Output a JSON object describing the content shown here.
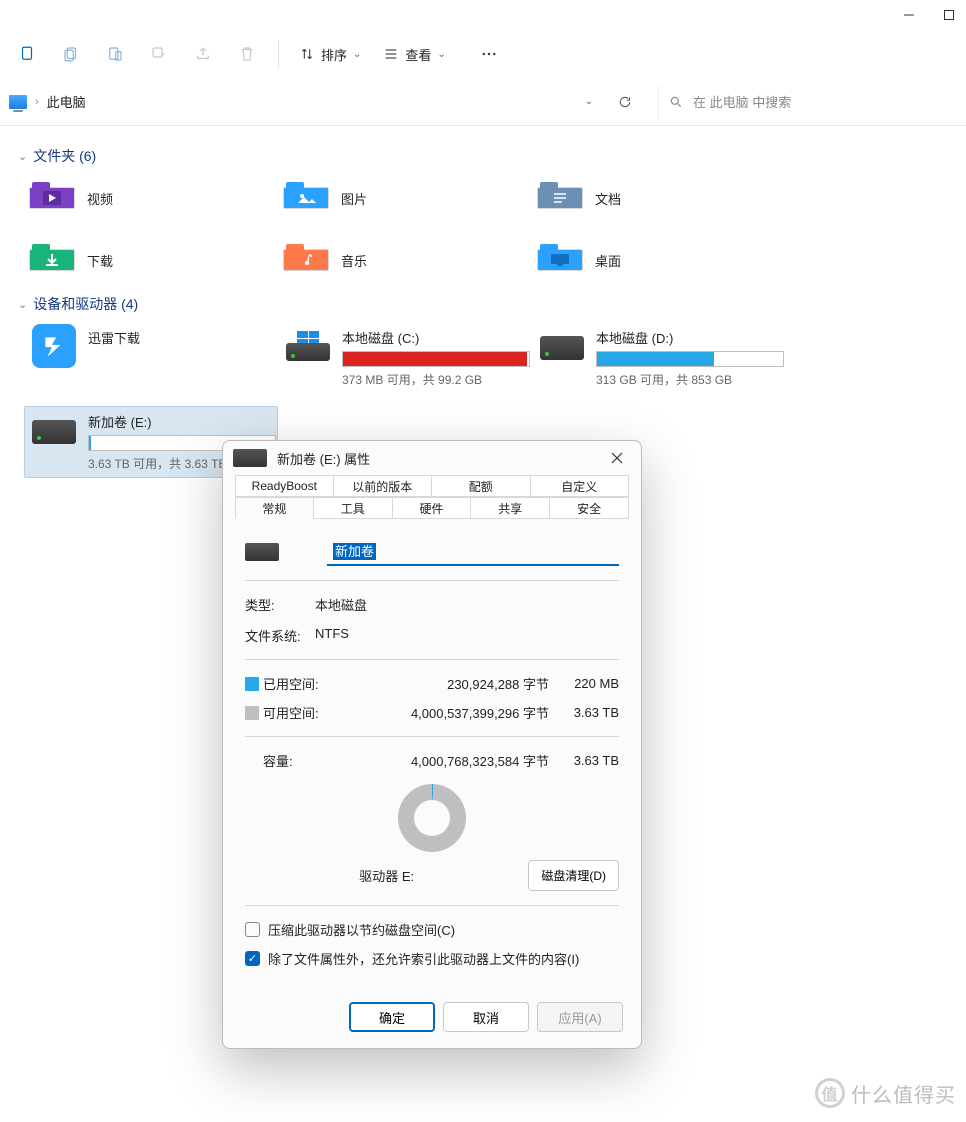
{
  "window_controls": {
    "min": "—",
    "max": "▢"
  },
  "toolbar": {
    "sort_label": "排序",
    "view_label": "查看"
  },
  "address": {
    "location": "此电脑",
    "search_placeholder": "在 此电脑 中搜索"
  },
  "sections": {
    "folders_header": "文件夹 (6)",
    "drives_header": "设备和驱动器 (4)"
  },
  "folders": [
    {
      "name": "视频"
    },
    {
      "name": "图片"
    },
    {
      "name": "文档"
    },
    {
      "name": "下载"
    },
    {
      "name": "音乐"
    },
    {
      "name": "桌面"
    }
  ],
  "drives": [
    {
      "name": "迅雷下载",
      "type": "app"
    },
    {
      "name": "本地磁盘 (C:)",
      "sub": "373 MB 可用，共 99.2 GB",
      "fill_pct": 99,
      "fill_color": "#d22"
    },
    {
      "name": "本地磁盘 (D:)",
      "sub": "313 GB 可用，共 853 GB",
      "fill_pct": 63,
      "fill_color": "#26a7e8"
    },
    {
      "name": "新加卷 (E:)",
      "sub": "3.63 TB 可用，共 3.63 TB",
      "fill_pct": 1,
      "fill_color": "#26a7e8",
      "selected": true
    }
  ],
  "dialog": {
    "title": "新加卷 (E:) 属性",
    "tabs_row1": [
      "ReadyBoost",
      "以前的版本",
      "配额",
      "自定义"
    ],
    "tabs_row2": [
      "常规",
      "工具",
      "硬件",
      "共享",
      "安全"
    ],
    "active_tab": "常规",
    "name_value": "新加卷",
    "type_label": "类型:",
    "type_value": "本地磁盘",
    "fs_label": "文件系统:",
    "fs_value": "NTFS",
    "used_label": "已用空间:",
    "used_bytes": "230,924,288 字节",
    "used_human": "220 MB",
    "free_label": "可用空间:",
    "free_bytes": "4,000,537,399,296 字节",
    "free_human": "3.63 TB",
    "cap_label": "容量:",
    "cap_bytes": "4,000,768,323,584 字节",
    "cap_human": "3.63 TB",
    "drive_label": "驱动器 E:",
    "cleanup": "磁盘清理(D)",
    "chk_compress": "压缩此驱动器以节约磁盘空间(C)",
    "chk_index": "除了文件属性外，还允许索引此驱动器上文件的内容(I)",
    "ok": "确定",
    "cancel": "取消",
    "apply": "应用(A)"
  },
  "watermark": "什么值得买"
}
